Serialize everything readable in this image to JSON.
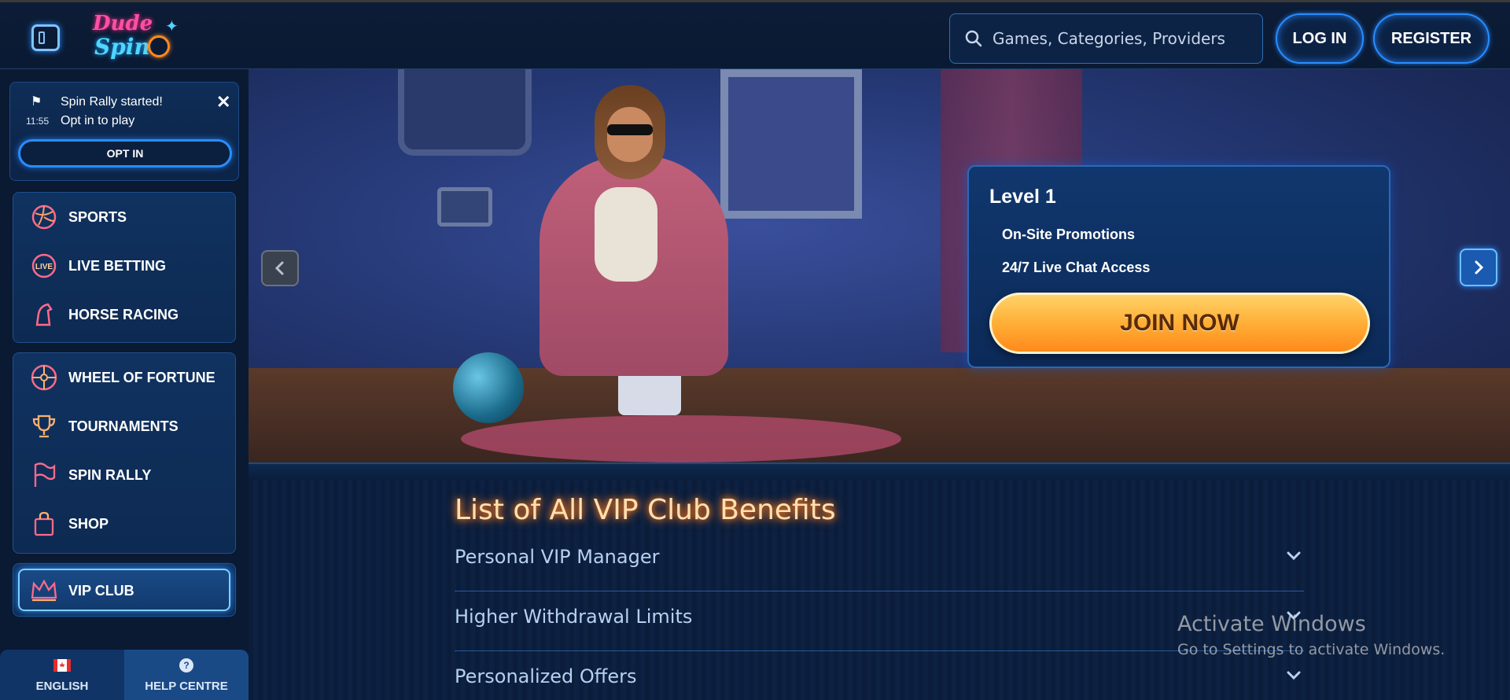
{
  "header": {
    "logo_top": "Dude",
    "logo_bottom": "Spin",
    "search_placeholder": "Games, Categories, Providers",
    "login_label": "LOG IN",
    "register_label": "REGISTER"
  },
  "notification": {
    "time": "11:55",
    "title": "Spin Rally started!",
    "subtitle": "Opt in to play",
    "optin_label": "OPT IN"
  },
  "sidebar": {
    "group1": [
      {
        "label": "SPORTS",
        "icon": "volleyball-icon"
      },
      {
        "label": "LIVE BETTING",
        "icon": "live-icon"
      },
      {
        "label": "HORSE RACING",
        "icon": "horse-icon"
      }
    ],
    "group2": [
      {
        "label": "WHEEL OF FORTUNE",
        "icon": "wheel-icon"
      },
      {
        "label": "TOURNAMENTS",
        "icon": "trophy-icon"
      },
      {
        "label": "SPIN RALLY",
        "icon": "flag-icon"
      },
      {
        "label": "SHOP",
        "icon": "shopping-bag-icon"
      }
    ],
    "vip": {
      "label": "VIP CLUB",
      "icon": "crown-icon"
    },
    "footer": {
      "language": "ENGLISH",
      "help": "HELP CENTRE"
    }
  },
  "banner": {
    "level": "Level 1",
    "benefits": [
      "On-Site Promotions",
      "24/7 Live Chat Access"
    ],
    "join_label": "JOIN NOW"
  },
  "vip_section": {
    "title": "List of All VIP Club Benefits",
    "items": [
      "Personal VIP Manager",
      "Higher Withdrawal Limits",
      "Personalized Offers"
    ]
  },
  "watermark": {
    "line1": "Activate Windows",
    "line2": "Go to Settings to activate Windows."
  },
  "colors": {
    "accent_blue": "#2a8cff",
    "cta_orange": "#ff8a1a",
    "bg": "#0a1a33"
  }
}
